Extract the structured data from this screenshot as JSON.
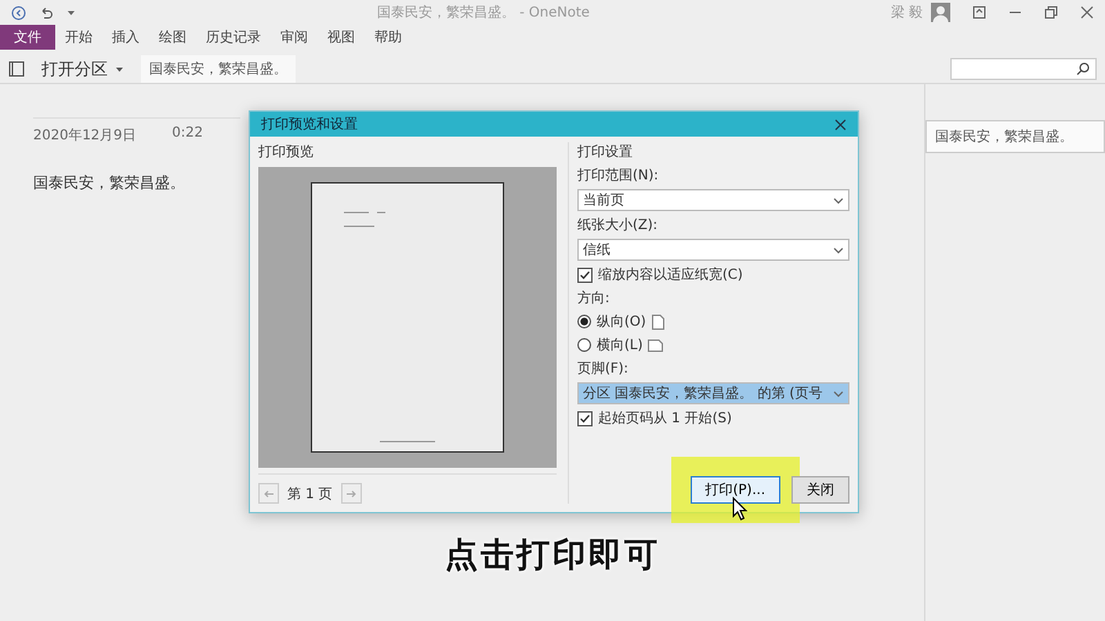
{
  "window": {
    "title": "国泰民安，繁荣昌盛。 - OneNote",
    "user": "梁 毅"
  },
  "ribbon_tabs": [
    {
      "label": "文件",
      "kind": "file",
      "selected": false
    },
    {
      "label": "开始",
      "kind": "tab",
      "selected": false
    },
    {
      "label": "插入",
      "kind": "tab",
      "selected": false
    },
    {
      "label": "绘图",
      "kind": "tab",
      "selected": false
    },
    {
      "label": "历史记录",
      "kind": "tab",
      "selected": false
    },
    {
      "label": "审阅",
      "kind": "tab",
      "selected": false
    },
    {
      "label": "视图",
      "kind": "tab",
      "selected": false
    },
    {
      "label": "帮助",
      "kind": "tab",
      "selected": false
    }
  ],
  "notebook": {
    "label": "打开分区"
  },
  "section_tabs": [
    {
      "label": "国泰民安，繁荣昌盛。",
      "selected": true
    }
  ],
  "page": {
    "date": "2020年12月9日",
    "time": "0:22",
    "body": "国泰民安，繁荣昌盛。"
  },
  "page_list": [
    {
      "title": "国泰民安，繁荣昌盛。",
      "selected": true
    }
  ],
  "dialog": {
    "title": "打印预览和设置",
    "preview_label": "打印预览",
    "page_nav": "第 1 页",
    "settings_label": "打印设置",
    "range_label": "打印范围(N):",
    "range_value": "当前页",
    "paper_label": "纸张大小(Z):",
    "paper_value": "信纸",
    "fit_width": {
      "label": "缩放内容以适应纸宽(C)",
      "checked": true
    },
    "orientation_label": "方向:",
    "orientations": [
      {
        "label": "纵向(O)",
        "selected": true,
        "kind": "portrait"
      },
      {
        "label": "横向(L)",
        "selected": false,
        "kind": "landscape"
      }
    ],
    "footer_label": "页脚(F):",
    "footer_value": "分区 国泰民安，繁荣昌盛。 的第 (页号",
    "start_page": {
      "label": "起始页码从 1 开始(S)",
      "checked": true
    },
    "buttons": [
      {
        "label": "打印(P)...",
        "kind": "primary"
      },
      {
        "label": "关闭",
        "kind": "normal"
      }
    ]
  },
  "caption": "点击打印即可"
}
